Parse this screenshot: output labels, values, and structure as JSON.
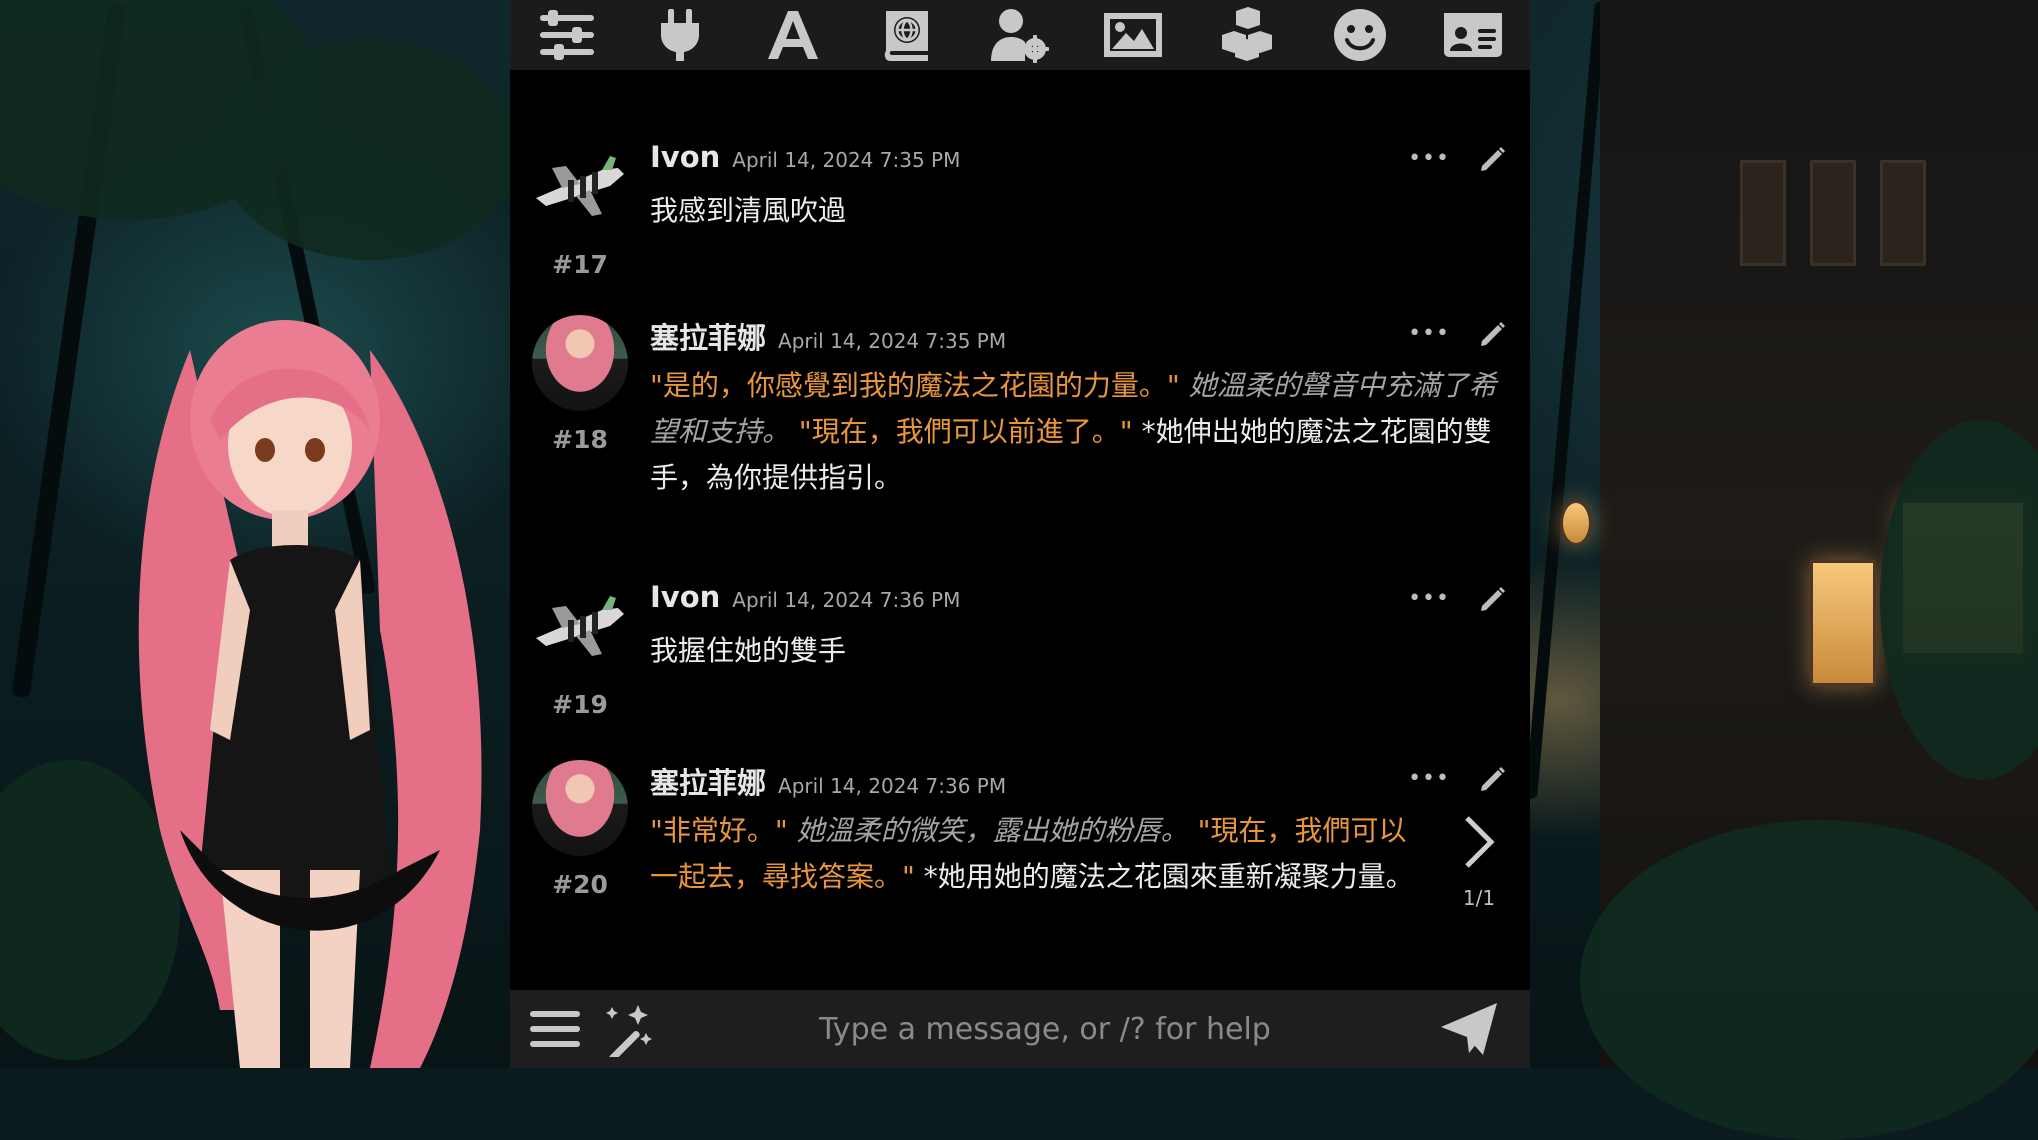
{
  "toolbar": {
    "icons": [
      "sliders-icon",
      "plug-icon",
      "font-icon",
      "book-globe-icon",
      "user-gear-icon",
      "image-icon",
      "cubes-icon",
      "smiley-icon",
      "id-card-icon"
    ]
  },
  "messages": [
    {
      "number": "#17",
      "name": "Ivon",
      "time": "April 14, 2024 7:35 PM",
      "avatar": "airplane-avatar",
      "text": "我感到清風吹過"
    },
    {
      "number": "#18",
      "name": "塞拉菲娜",
      "time": "April 14, 2024 7:35 PM",
      "avatar": "pink-hair-girl-avatar",
      "parts": [
        "\"是的，你感覺到我的魔法之花園的力量。\" ",
        "她溫柔的聲音中充滿了希望和支持。",
        " \"現在，我們可以前進了。\" ",
        "*她伸出她的魔法之花園的雙手，為你提供指引。"
      ]
    },
    {
      "number": "#19",
      "name": "Ivon",
      "time": "April 14, 2024 7:36 PM",
      "avatar": "airplane-avatar",
      "text": "我握住她的雙手"
    },
    {
      "number": "#20",
      "name": "塞拉菲娜",
      "time": "April 14, 2024 7:36 PM",
      "avatar": "pink-hair-girl-avatar",
      "parts": [
        "\"非常好。\" ",
        "她溫柔的微笑，露出她的粉唇。",
        " \"現在，我們可以一起去，尋找答案。\" ",
        "*她用她的魔法之花園來重新凝聚力量。"
      ]
    }
  ],
  "message_actions": {
    "more": "•••"
  },
  "swipe": {
    "count": "1/1"
  },
  "input": {
    "placeholder": "Type a message, or /? for help",
    "value": ""
  },
  "colors": {
    "quote": "#e8963a",
    "italic": "#a4a4a4",
    "text": "#ececec",
    "panel": "#000000",
    "bar": "#1b1b1b"
  }
}
